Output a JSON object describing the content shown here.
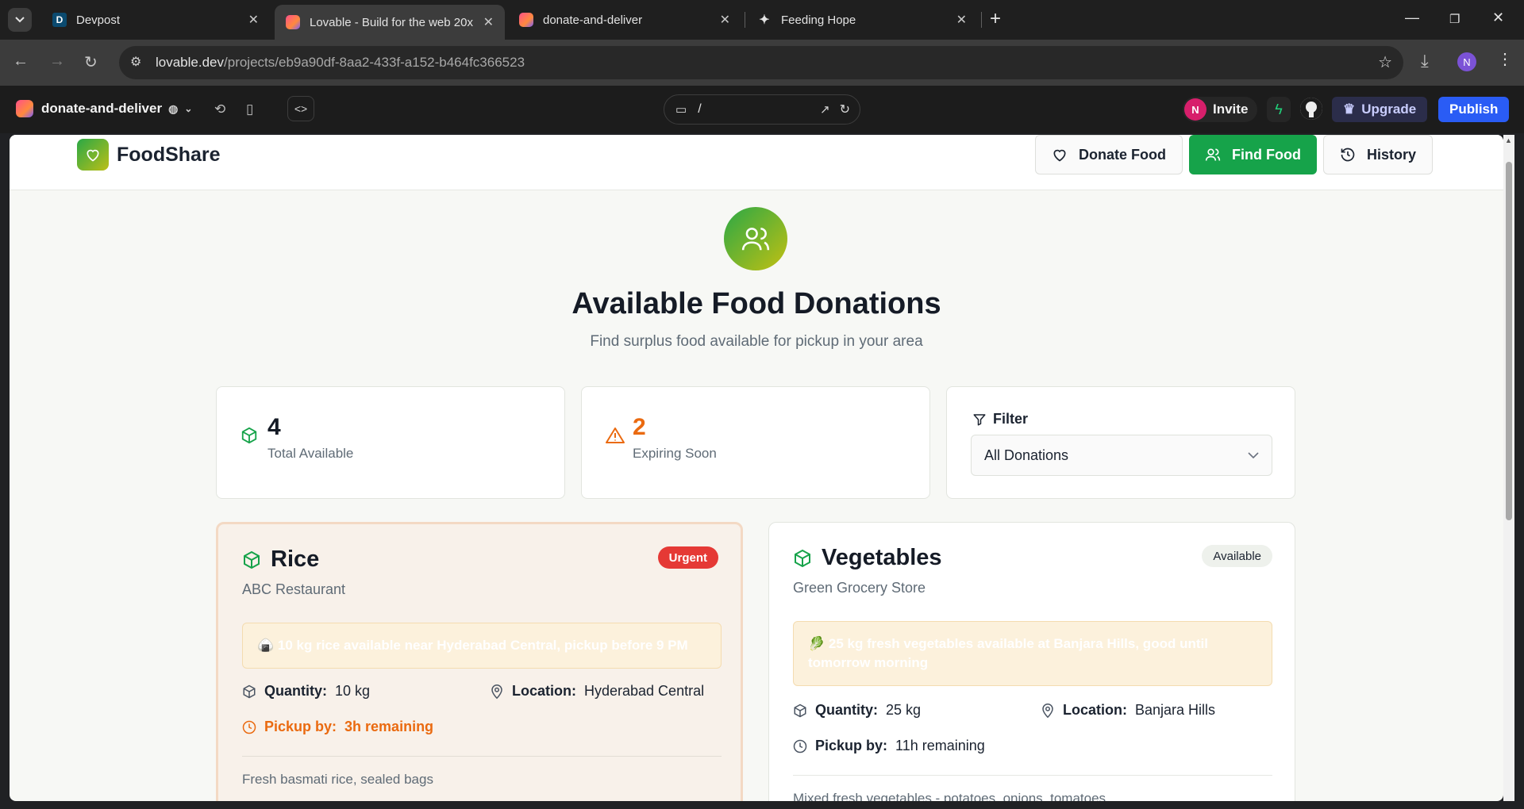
{
  "browser": {
    "tabs": [
      {
        "title": "Devpost",
        "favicon": "D"
      },
      {
        "title": "Lovable - Build for the web 20x",
        "favicon": "lovable"
      },
      {
        "title": "donate-and-deliver",
        "favicon": "lovable"
      },
      {
        "title": "Feeding Hope",
        "favicon": "sparkle"
      }
    ],
    "url_host": "lovable.dev",
    "url_path": "/projects/eb9a90df-8aa2-433f-a152-b464fc366523",
    "profile_initial": "N"
  },
  "lovable": {
    "project_name": "donate-and-deliver",
    "route": "/",
    "invite_initial": "N",
    "invite_label": "Invite",
    "upgrade_label": "Upgrade",
    "publish_label": "Publish"
  },
  "app": {
    "brand": "FoodShare",
    "nav": {
      "donate": "Donate Food",
      "find": "Find Food",
      "history": "History"
    },
    "hero_title": "Available Food Donations",
    "hero_subtitle": "Find surplus food available for pickup in your area",
    "stats": {
      "total_value": "4",
      "total_label": "Total Available",
      "expiring_value": "2",
      "expiring_label": "Expiring Soon"
    },
    "filter": {
      "label": "Filter",
      "selected": "All Donations"
    },
    "cards": [
      {
        "title": "Rice",
        "donor": "ABC Restaurant",
        "badge": "Urgent",
        "note": "🍙 10 kg rice available near Hyderabad Central, pickup before 9 PM",
        "quantity_label": "Quantity:",
        "quantity": "10 kg",
        "location_label": "Location:",
        "location": "Hyderabad Central",
        "pickup_label": "Pickup by:",
        "pickup": "3h remaining",
        "description": "Fresh basmati rice, sealed bags"
      },
      {
        "title": "Vegetables",
        "donor": "Green Grocery Store",
        "badge": "Available",
        "note": "🥬 25 kg fresh vegetables available at Banjara Hills, good until tomorrow morning",
        "quantity_label": "Quantity:",
        "quantity": "25 kg",
        "location_label": "Location:",
        "location": "Banjara Hills",
        "pickup_label": "Pickup by:",
        "pickup": "11h remaining",
        "description": "Mixed fresh vegetables - potatoes, onions, tomatoes"
      }
    ]
  },
  "colors": {
    "accent_green": "#16a34a",
    "urgent_red": "#e53935",
    "warning_orange": "#ea6a10",
    "publish_blue": "#2a5cf5"
  }
}
